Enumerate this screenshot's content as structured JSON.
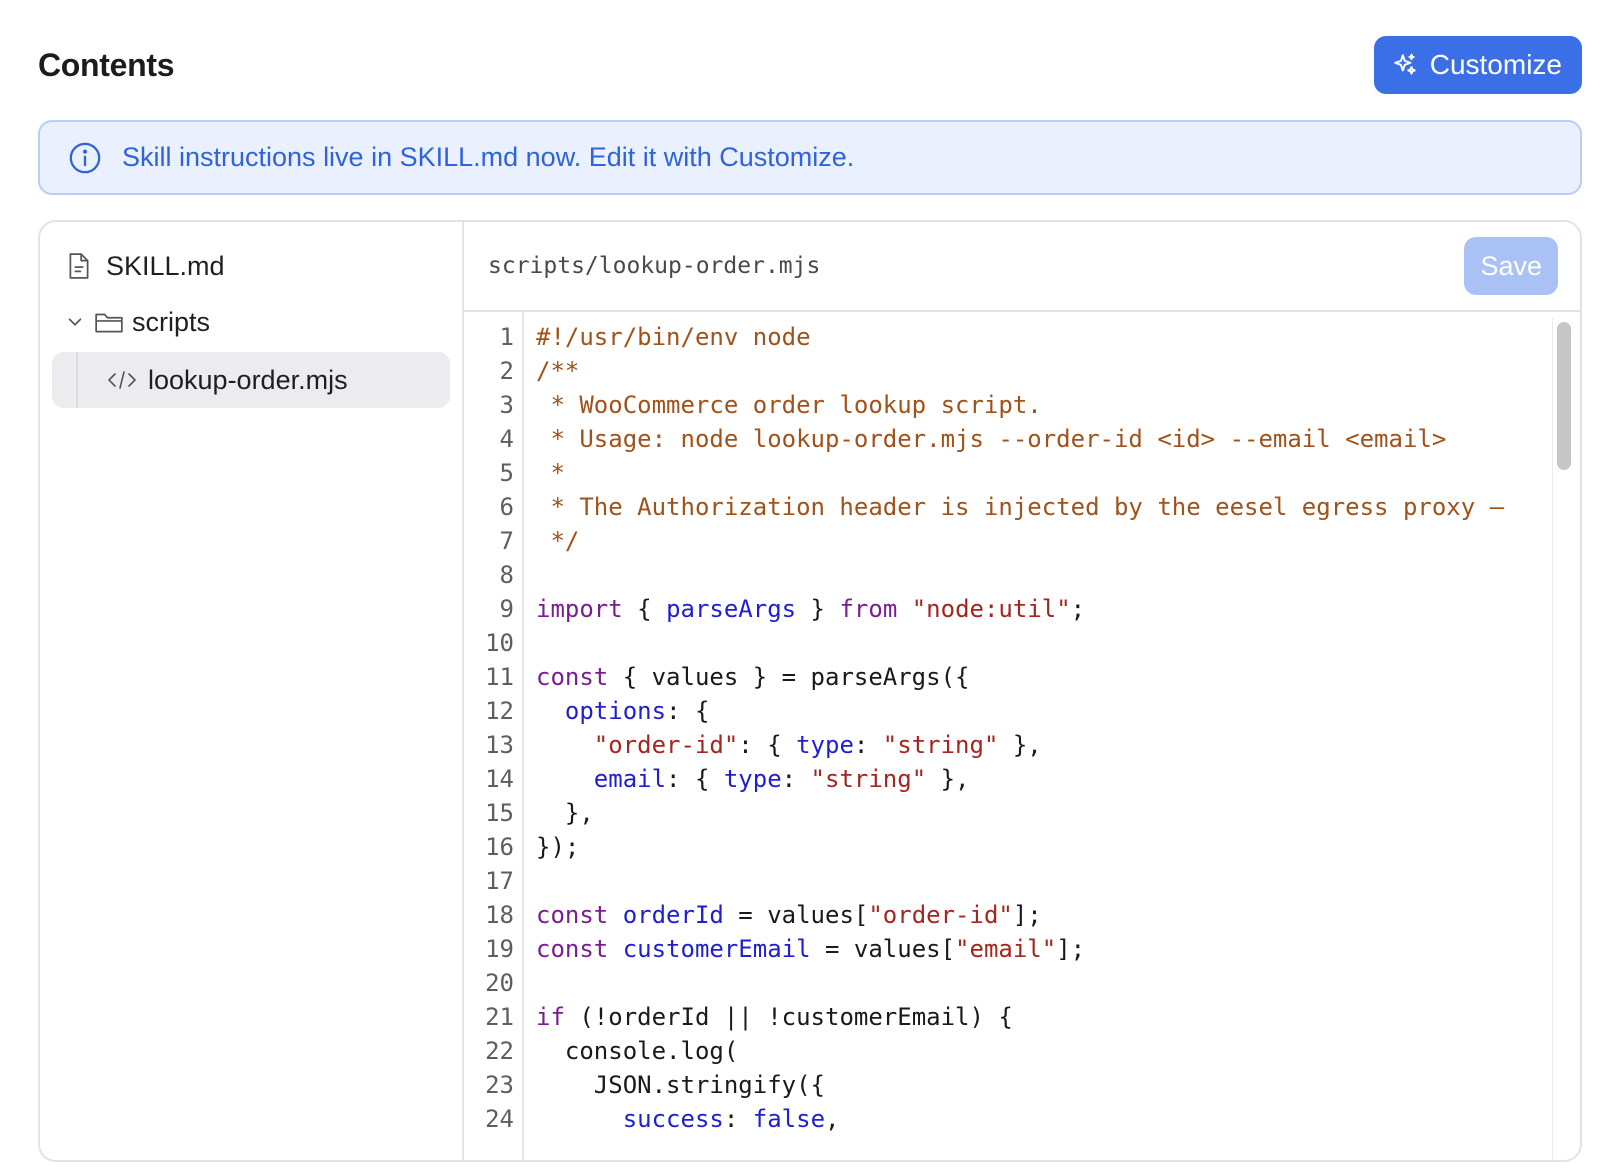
{
  "header": {
    "title": "Contents",
    "customize_label": "Customize",
    "customize_icon": "sparkles-icon"
  },
  "banner": {
    "icon": "info-icon",
    "text": "Skill instructions live in SKILL.md now. Edit it with Customize."
  },
  "tree": {
    "root_file": {
      "label": "SKILL.md",
      "icon": "file-text-icon"
    },
    "folder": {
      "label": "scripts",
      "icon": "folder-icon",
      "expanded": true
    },
    "children": [
      {
        "label": "lookup-order.mjs",
        "icon": "code-icon",
        "selected": true
      }
    ]
  },
  "editor": {
    "file_path": "scripts/lookup-order.mjs",
    "save_label": "Save",
    "lines": [
      [
        [
          "c",
          "#!/usr/bin/env node"
        ]
      ],
      [
        [
          "c",
          "/**"
        ]
      ],
      [
        [
          "c",
          " * WooCommerce order lookup script."
        ]
      ],
      [
        [
          "c",
          " * Usage: node lookup-order.mjs --order-id <id> --email <email>"
        ]
      ],
      [
        [
          "c",
          " *"
        ]
      ],
      [
        [
          "c",
          " * The Authorization header is injected by the eesel egress proxy —"
        ]
      ],
      [
        [
          "c",
          " */"
        ]
      ],
      [],
      [
        [
          "k",
          "import"
        ],
        [
          "p",
          " { "
        ],
        [
          "v",
          "parseArgs"
        ],
        [
          "p",
          " } "
        ],
        [
          "k",
          "from"
        ],
        [
          "p",
          " "
        ],
        [
          "s",
          "\"node:util\""
        ],
        [
          "p",
          ";"
        ]
      ],
      [],
      [
        [
          "k",
          "const"
        ],
        [
          "p",
          " { values } = parseArgs({"
        ]
      ],
      [
        [
          "p",
          "  "
        ],
        [
          "v",
          "options"
        ],
        [
          "p",
          ": {"
        ]
      ],
      [
        [
          "p",
          "    "
        ],
        [
          "s",
          "\"order-id\""
        ],
        [
          "p",
          ": { "
        ],
        [
          "v",
          "type"
        ],
        [
          "p",
          ": "
        ],
        [
          "s",
          "\"string\""
        ],
        [
          "p",
          " },"
        ]
      ],
      [
        [
          "p",
          "    "
        ],
        [
          "v",
          "email"
        ],
        [
          "p",
          ": { "
        ],
        [
          "v",
          "type"
        ],
        [
          "p",
          ": "
        ],
        [
          "s",
          "\"string\""
        ],
        [
          "p",
          " },"
        ]
      ],
      [
        [
          "p",
          "  },"
        ]
      ],
      [
        [
          "p",
          "});"
        ]
      ],
      [],
      [
        [
          "k",
          "const"
        ],
        [
          "p",
          " "
        ],
        [
          "v",
          "orderId"
        ],
        [
          "p",
          " = values["
        ],
        [
          "s",
          "\"order-id\""
        ],
        [
          "p",
          "];"
        ]
      ],
      [
        [
          "k",
          "const"
        ],
        [
          "p",
          " "
        ],
        [
          "v",
          "customerEmail"
        ],
        [
          "p",
          " = values["
        ],
        [
          "s",
          "\"email\""
        ],
        [
          "p",
          "];"
        ]
      ],
      [],
      [
        [
          "k",
          "if"
        ],
        [
          "p",
          " (!orderId || !customerEmail) {"
        ]
      ],
      [
        [
          "p",
          "  console.log("
        ]
      ],
      [
        [
          "p",
          "    JSON.stringify({"
        ]
      ],
      [
        [
          "p",
          "      "
        ],
        [
          "v",
          "success"
        ],
        [
          "p",
          ": "
        ],
        [
          "v",
          "false"
        ],
        [
          "p",
          ","
        ]
      ]
    ]
  }
}
